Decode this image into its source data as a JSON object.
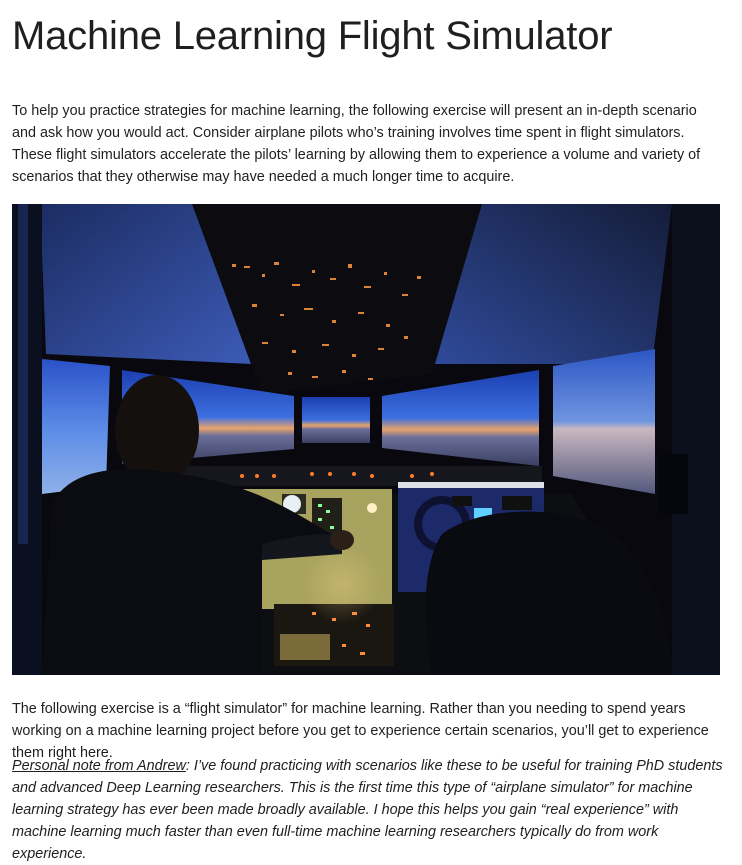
{
  "page": {
    "title": "Machine Learning Flight Simulator",
    "intro": "To help you practice strategies for machine learning, the following exercise will present an in-depth scenario and ask how you would act. Consider airplane pilots who’s training involves time spent in flight simulators. These flight simulators accelerate the pilots’ learning by allowing them to experience a volume and variety of scenarios that they otherwise may have needed a much longer time to acquire.",
    "image": {
      "alt": "Pilot seated in a flight simulator cockpit facing illuminated windows and instrument panels"
    },
    "after_image": "The following exercise is a “flight simulator” for machine learning. Rather than you needing to spend years working on a machine learning project before you get to experience certain scenarios, you’ll get to experience them right here.",
    "note": {
      "label": "Personal note from Andrew",
      "text": ": I’ve found practicing with scenarios like these to be useful for training PhD students and advanced Deep Learning researchers. This is the first time this type of “airplane simulator” for machine learning strategy has ever been made broadly available. I hope this helps you gain “real experience” with machine learning much faster than even full-time machine learning researchers typically do from work experience."
    }
  }
}
